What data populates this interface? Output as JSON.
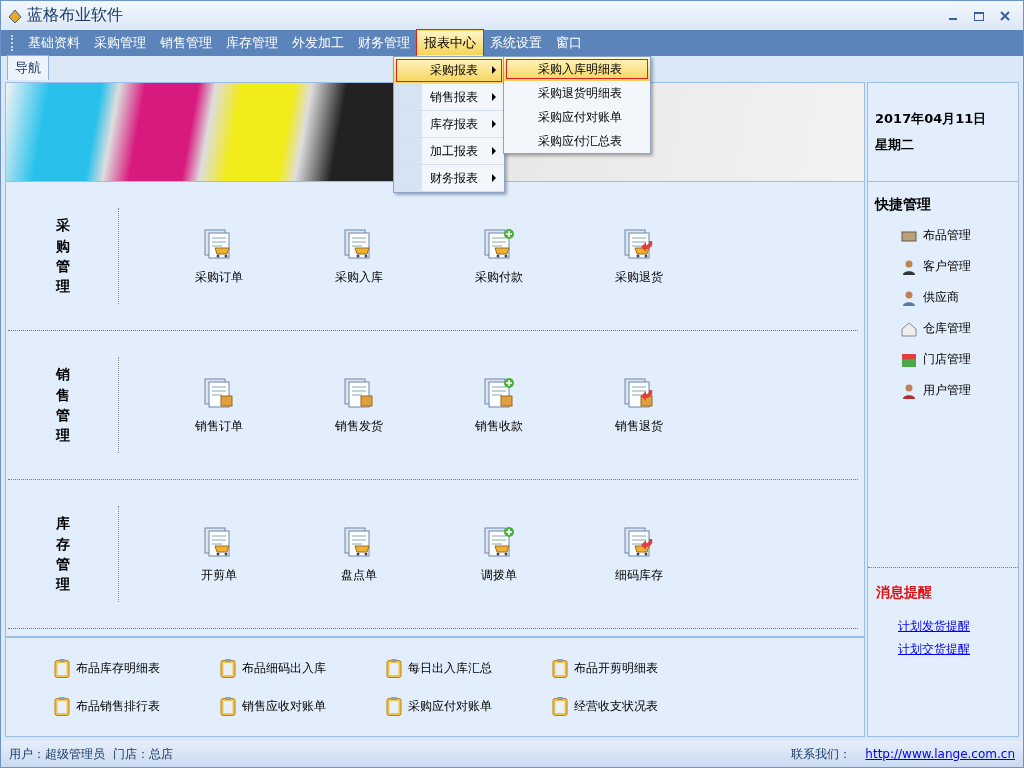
{
  "window": {
    "title": "蓝格布业软件"
  },
  "menu": [
    {
      "label": "基础资料",
      "selected": false
    },
    {
      "label": "采购管理",
      "selected": false
    },
    {
      "label": "销售管理",
      "selected": false
    },
    {
      "label": "库存管理",
      "selected": false
    },
    {
      "label": "外发加工",
      "selected": false
    },
    {
      "label": "财务管理",
      "selected": false
    },
    {
      "label": "报表中心",
      "selected": true
    },
    {
      "label": "系统设置",
      "selected": false
    },
    {
      "label": "窗口",
      "selected": false
    }
  ],
  "report_menu": [
    {
      "label": "采购报表",
      "selected": true
    },
    {
      "label": "销售报表",
      "selected": false
    },
    {
      "label": "库存报表",
      "selected": false
    },
    {
      "label": "加工报表",
      "selected": false
    },
    {
      "label": "财务报表",
      "selected": false
    }
  ],
  "report_submenu": [
    {
      "label": "采购入库明细表",
      "selected": true
    },
    {
      "label": "采购退货明细表",
      "selected": false
    },
    {
      "label": "采购应付对账单",
      "selected": false
    },
    {
      "label": "采购应付汇总表",
      "selected": false
    }
  ],
  "tabs": [
    {
      "label": "导航",
      "selected": true
    }
  ],
  "date": "2017年04月11日",
  "weekday": "星期二",
  "sections": [
    {
      "title": "采购管理",
      "items": [
        "采购订单",
        "采购入库",
        "采购付款",
        "采购退货"
      ]
    },
    {
      "title": "销售管理",
      "items": [
        "销售订单",
        "销售发货",
        "销售收款",
        "销售退货"
      ]
    },
    {
      "title": "库存管理",
      "items": [
        "开剪单",
        "盘点单",
        "调拨单",
        "细码库存"
      ]
    }
  ],
  "reports": [
    "布品库存明细表",
    "布品细码出入库",
    "每日出入库汇总",
    "布品开剪明细表",
    "布品销售排行表",
    "销售应收对账单",
    "采购应付对账单",
    "经营收支状况表"
  ],
  "quick": {
    "title": "快捷管理",
    "items": [
      "布品管理",
      "客户管理",
      "供应商",
      "仓库管理",
      "门店管理",
      "用户管理"
    ]
  },
  "alerts": {
    "title": "消息提醒",
    "links": [
      "计划发货提醒",
      "计划交货提醒"
    ]
  },
  "status": {
    "user": "用户：超级管理员",
    "store": "门店：总店",
    "contact_label": "联系我们：",
    "url": "http://www.lange.com.cn"
  }
}
